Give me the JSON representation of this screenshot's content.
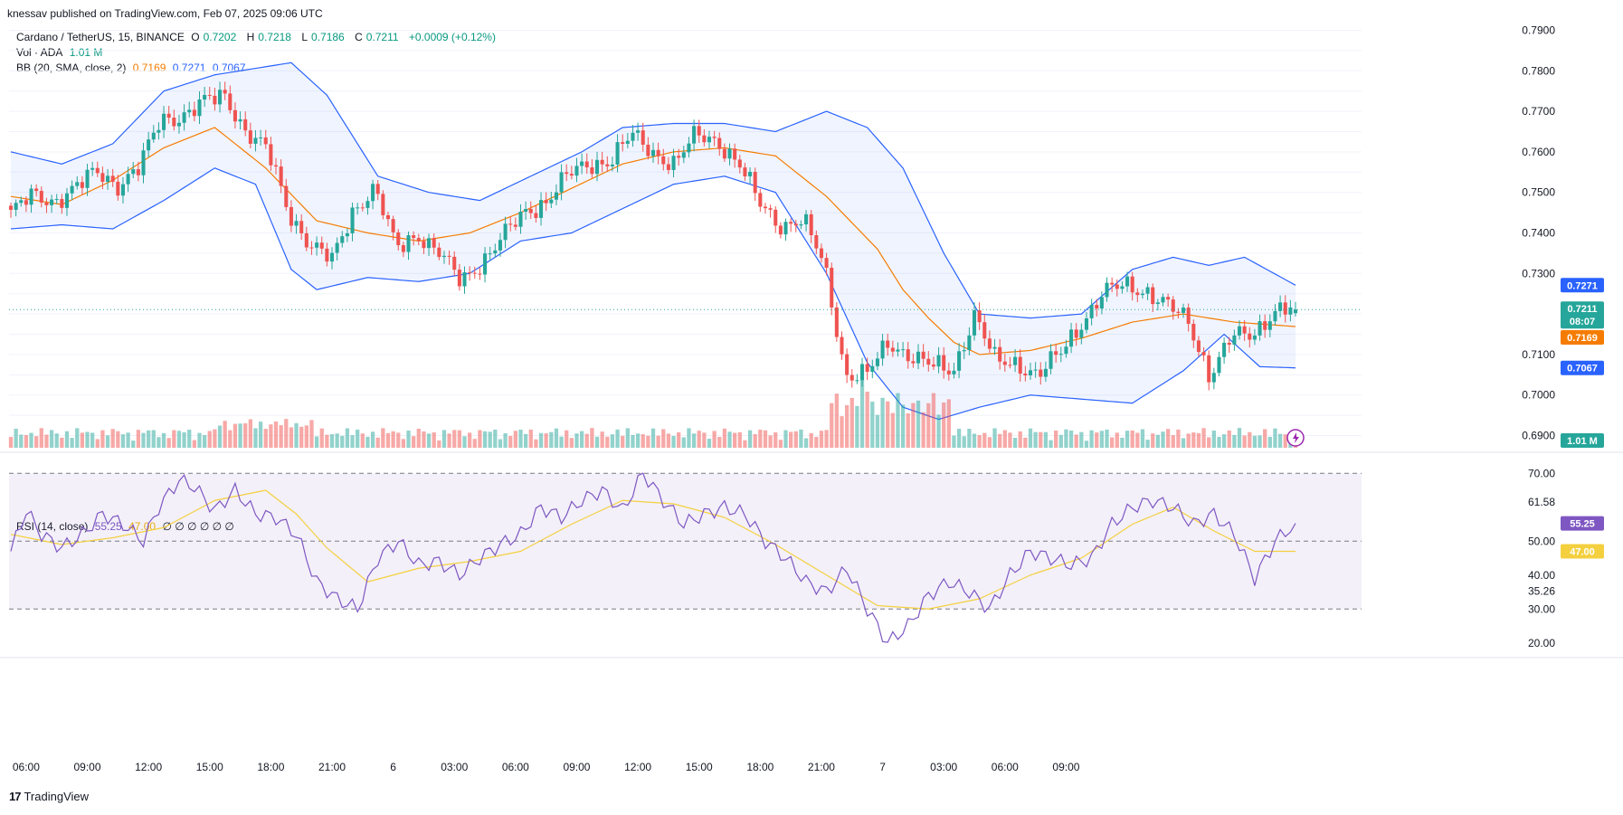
{
  "header": {
    "publisher_line": "knessav published on TradingView.com, Feb 07, 2025 09:06 UTC"
  },
  "legend": {
    "symbol": "Cardano / TetherUS, 15, BINANCE",
    "o_label": "O",
    "o_value": "0.7202",
    "h_label": "H",
    "h_value": "0.7218",
    "l_label": "L",
    "l_value": "0.7186",
    "c_label": "C",
    "c_value": "0.7211",
    "change": "+0.0009 (+0.12%)",
    "vol_label": "Vol · ADA",
    "vol_value": "1.01 M",
    "bb_label": "BB (20, SMA, close, 2)",
    "bb_mid": "0.7169",
    "bb_upper": "0.7271",
    "bb_lower": "0.7067",
    "rsi_label": "RSI (14, close)",
    "rsi_value": "55.25",
    "rsi_ma": "47.00",
    "rsi_empty": "∅ ∅ ∅ ∅ ∅ ∅"
  },
  "price_axis": {
    "ticks": [
      "0.7900",
      "0.7800",
      "0.7700",
      "0.7600",
      "0.7500",
      "0.7400",
      "0.7300",
      "0.7100",
      "0.7000",
      "0.6900"
    ]
  },
  "tags": {
    "upper": "0.7271",
    "last_price": "0.7211",
    "countdown": "08:07",
    "mid": "0.7169",
    "lower": "0.7067",
    "volume": "1.01 M",
    "rsi_value": "55.25",
    "rsi_ma": "47.00"
  },
  "rsi_axis": {
    "ticks": [
      "70.00",
      "61.58",
      "50.00",
      "40.00",
      "35.26",
      "30.00",
      "20.00"
    ]
  },
  "time_axis": {
    "ticks": [
      "06:00",
      "09:00",
      "12:00",
      "15:00",
      "18:00",
      "21:00",
      "6",
      "03:00",
      "06:00",
      "09:00",
      "12:00",
      "15:00",
      "18:00",
      "21:00",
      "7",
      "03:00",
      "06:00",
      "09:00"
    ]
  },
  "footer": {
    "brand": "TradingView"
  },
  "colors": {
    "up": "#26a69a",
    "down": "#ef5350",
    "bb_band": "#2962ff",
    "bb_basis": "#f57c00",
    "rsi": "#7e57c2",
    "rsi_ma": "#f4d03f"
  },
  "chart_data": [
    {
      "type": "candlestick",
      "title": "Cardano / TetherUS, 15, BINANCE",
      "x_range": [
        "2025-02-05 05:15",
        "2025-02-07 09:00"
      ],
      "ylim": [
        0.687,
        0.793
      ],
      "close_anchors": [
        {
          "t": "05:15",
          "v": 0.745
        },
        {
          "t": "06:00",
          "v": 0.749
        },
        {
          "t": "07:00",
          "v": 0.748
        },
        {
          "t": "08:00",
          "v": 0.751
        },
        {
          "t": "09:00",
          "v": 0.755
        },
        {
          "t": "10:00",
          "v": 0.752
        },
        {
          "t": "11:00",
          "v": 0.756
        },
        {
          "t": "12:00",
          "v": 0.768
        },
        {
          "t": "13:00",
          "v": 0.769
        },
        {
          "t": "14:00",
          "v": 0.772
        },
        {
          "t": "14:45",
          "v": 0.774
        },
        {
          "t": "15:15",
          "v": 0.765
        },
        {
          "t": "16:00",
          "v": 0.76
        },
        {
          "t": "17:00",
          "v": 0.745
        },
        {
          "t": "18:00",
          "v": 0.737
        },
        {
          "t": "18:45",
          "v": 0.733
        },
        {
          "t": "19:30",
          "v": 0.746
        },
        {
          "t": "20:30",
          "v": 0.751
        },
        {
          "t": "21:00",
          "v": 0.736
        },
        {
          "t": "22:00",
          "v": 0.74
        },
        {
          "t": "23:00",
          "v": 0.735
        },
        {
          "t": "23:45",
          "v": 0.728
        },
        {
          "t": "00:30",
          "v": 0.733
        },
        {
          "t": "01:30",
          "v": 0.739
        },
        {
          "t": "02:30",
          "v": 0.745
        },
        {
          "t": "03:00",
          "v": 0.748
        },
        {
          "t": "04:00",
          "v": 0.754
        },
        {
          "t": "05:00",
          "v": 0.757
        },
        {
          "t": "06:00",
          "v": 0.758
        },
        {
          "t": "06:45",
          "v": 0.764
        },
        {
          "t": "07:30",
          "v": 0.76
        },
        {
          "t": "08:30",
          "v": 0.757
        },
        {
          "t": "09:00",
          "v": 0.764
        },
        {
          "t": "10:00",
          "v": 0.763
        },
        {
          "t": "11:00",
          "v": 0.757
        },
        {
          "t": "12:00",
          "v": 0.747
        },
        {
          "t": "13:00",
          "v": 0.742
        },
        {
          "t": "14:00",
          "v": 0.743
        },
        {
          "t": "14:45",
          "v": 0.732
        },
        {
          "t": "15:30",
          "v": 0.705
        },
        {
          "t": "16:15",
          "v": 0.705
        },
        {
          "t": "17:00",
          "v": 0.713
        },
        {
          "t": "18:00",
          "v": 0.71
        },
        {
          "t": "19:00",
          "v": 0.707
        },
        {
          "t": "20:00",
          "v": 0.706
        },
        {
          "t": "20:45",
          "v": 0.72
        },
        {
          "t": "21:30",
          "v": 0.708
        },
        {
          "t": "22:30",
          "v": 0.708
        },
        {
          "t": "23:30",
          "v": 0.705
        },
        {
          "t": "00:30",
          "v": 0.71
        },
        {
          "t": "01:30",
          "v": 0.718
        },
        {
          "t": "02:15",
          "v": 0.725
        },
        {
          "t": "03:00",
          "v": 0.727
        },
        {
          "t": "04:00",
          "v": 0.726
        },
        {
          "t": "04:45",
          "v": 0.722
        },
        {
          "t": "05:30",
          "v": 0.718
        },
        {
          "t": "06:15",
          "v": 0.705
        },
        {
          "t": "07:00",
          "v": 0.714
        },
        {
          "t": "08:00",
          "v": 0.715
        },
        {
          "t": "08:45",
          "v": 0.721
        },
        {
          "t": "09:00",
          "v": 0.7211
        }
      ],
      "last": {
        "open": 0.7202,
        "high": 0.7218,
        "low": 0.7186,
        "close": 0.7211
      }
    },
    {
      "type": "line",
      "title": "BB (20, SMA, close, 2)",
      "series": [
        {
          "name": "basis",
          "anchors": [
            [
              0,
              0.749
            ],
            [
              10,
              0.747
            ],
            [
              20,
              0.753
            ],
            [
              30,
              0.761
            ],
            [
              40,
              0.766
            ],
            [
              50,
              0.756
            ],
            [
              60,
              0.743
            ],
            [
              70,
              0.74
            ],
            [
              80,
              0.738
            ],
            [
              90,
              0.74
            ],
            [
              100,
              0.745
            ],
            [
              110,
              0.751
            ],
            [
              120,
              0.757
            ],
            [
              130,
              0.76
            ],
            [
              140,
              0.761
            ],
            [
              150,
              0.759
            ],
            [
              160,
              0.749
            ],
            [
              170,
              0.736
            ],
            [
              175,
              0.726
            ],
            [
              180,
              0.719
            ],
            [
              185,
              0.713
            ],
            [
              190,
              0.71
            ],
            [
              200,
              0.711
            ],
            [
              210,
              0.714
            ],
            [
              220,
              0.718
            ],
            [
              230,
              0.72
            ],
            [
              240,
              0.718
            ],
            [
              252,
              0.7169
            ]
          ]
        },
        {
          "name": "upper",
          "anchors": [
            [
              0,
              0.76
            ],
            [
              10,
              0.757
            ],
            [
              20,
              0.762
            ],
            [
              30,
              0.775
            ],
            [
              40,
              0.779
            ],
            [
              50,
              0.781
            ],
            [
              55,
              0.782
            ],
            [
              62,
              0.774
            ],
            [
              72,
              0.754
            ],
            [
              82,
              0.75
            ],
            [
              92,
              0.748
            ],
            [
              102,
              0.754
            ],
            [
              112,
              0.76
            ],
            [
              120,
              0.766
            ],
            [
              130,
              0.767
            ],
            [
              140,
              0.767
            ],
            [
              150,
              0.765
            ],
            [
              160,
              0.77
            ],
            [
              168,
              0.766
            ],
            [
              175,
              0.756
            ],
            [
              183,
              0.735
            ],
            [
              190,
              0.72
            ],
            [
              200,
              0.719
            ],
            [
              210,
              0.72
            ],
            [
              220,
              0.731
            ],
            [
              228,
              0.734
            ],
            [
              235,
              0.732
            ],
            [
              242,
              0.734
            ],
            [
              252,
              0.7271
            ]
          ]
        },
        {
          "name": "lower",
          "anchors": [
            [
              0,
              0.741
            ],
            [
              10,
              0.742
            ],
            [
              20,
              0.741
            ],
            [
              30,
              0.748
            ],
            [
              40,
              0.756
            ],
            [
              48,
              0.752
            ],
            [
              55,
              0.731
            ],
            [
              60,
              0.726
            ],
            [
              70,
              0.729
            ],
            [
              80,
              0.728
            ],
            [
              90,
              0.73
            ],
            [
              100,
              0.738
            ],
            [
              110,
              0.74
            ],
            [
              120,
              0.746
            ],
            [
              130,
              0.752
            ],
            [
              140,
              0.754
            ],
            [
              150,
              0.75
            ],
            [
              160,
              0.73
            ],
            [
              168,
              0.708
            ],
            [
              175,
              0.697
            ],
            [
              182,
              0.694
            ],
            [
              190,
              0.697
            ],
            [
              200,
              0.7
            ],
            [
              210,
              0.699
            ],
            [
              220,
              0.698
            ],
            [
              230,
              0.706
            ],
            [
              238,
              0.715
            ],
            [
              245,
              0.707
            ],
            [
              252,
              0.7067
            ]
          ]
        }
      ]
    },
    {
      "type": "bar",
      "title": "Vol · ADA",
      "last_value": "1.01 M"
    },
    {
      "type": "line",
      "title": "RSI (14, close)",
      "ylim": [
        17,
        73
      ],
      "series": [
        {
          "name": "RSI",
          "anchors": [
            [
              0,
              47
            ],
            [
              3,
              59
            ],
            [
              6,
              52
            ],
            [
              10,
              48
            ],
            [
              14,
              52
            ],
            [
              18,
              58
            ],
            [
              22,
              55
            ],
            [
              26,
              50
            ],
            [
              29,
              60
            ],
            [
              33,
              68
            ],
            [
              36,
              66
            ],
            [
              40,
              59
            ],
            [
              44,
              65
            ],
            [
              48,
              58
            ],
            [
              52,
              57
            ],
            [
              56,
              52
            ],
            [
              60,
              38
            ],
            [
              64,
              33
            ],
            [
              68,
              30
            ],
            [
              72,
              45
            ],
            [
              76,
              50
            ],
            [
              80,
              43
            ],
            [
              84,
              44
            ],
            [
              88,
              40
            ],
            [
              92,
              45
            ],
            [
              96,
              49
            ],
            [
              100,
              52
            ],
            [
              104,
              60
            ],
            [
              108,
              57
            ],
            [
              112,
              62
            ],
            [
              116,
              65
            ],
            [
              120,
              59
            ],
            [
              124,
              70
            ],
            [
              128,
              62
            ],
            [
              132,
              55
            ],
            [
              136,
              58
            ],
            [
              140,
              60
            ],
            [
              144,
              58
            ],
            [
              148,
              50
            ],
            [
              152,
              45
            ],
            [
              156,
              38
            ],
            [
              160,
              35
            ],
            [
              164,
              42
            ],
            [
              168,
              30
            ],
            [
              172,
              20
            ],
            [
              176,
              25
            ],
            [
              180,
              34
            ],
            [
              184,
              38
            ],
            [
              188,
              35
            ],
            [
              192,
              30
            ],
            [
              196,
              40
            ],
            [
              200,
              47
            ],
            [
              204,
              45
            ],
            [
              208,
              43
            ],
            [
              212,
              45
            ],
            [
              216,
              55
            ],
            [
              220,
              60
            ],
            [
              224,
              62
            ],
            [
              228,
              60
            ],
            [
              232,
              55
            ],
            [
              236,
              58
            ],
            [
              240,
              52
            ],
            [
              244,
              39
            ],
            [
              248,
              50
            ],
            [
              252,
              55.25
            ]
          ]
        },
        {
          "name": "RSI MA",
          "anchors": [
            [
              0,
              52
            ],
            [
              10,
              49
            ],
            [
              20,
              51
            ],
            [
              30,
              54
            ],
            [
              40,
              62
            ],
            [
              50,
              65
            ],
            [
              56,
              58
            ],
            [
              62,
              48
            ],
            [
              70,
              38
            ],
            [
              80,
              42
            ],
            [
              90,
              44
            ],
            [
              100,
              47
            ],
            [
              110,
              55
            ],
            [
              120,
              62
            ],
            [
              130,
              61
            ],
            [
              140,
              57
            ],
            [
              150,
              49
            ],
            [
              160,
              40
            ],
            [
              170,
              31
            ],
            [
              180,
              30
            ],
            [
              190,
              33
            ],
            [
              200,
              40
            ],
            [
              210,
              45
            ],
            [
              220,
              55
            ],
            [
              228,
              60
            ],
            [
              236,
              53
            ],
            [
              244,
              47
            ],
            [
              252,
              47
            ]
          ]
        }
      ],
      "levels": [
        70,
        50,
        30
      ]
    }
  ]
}
